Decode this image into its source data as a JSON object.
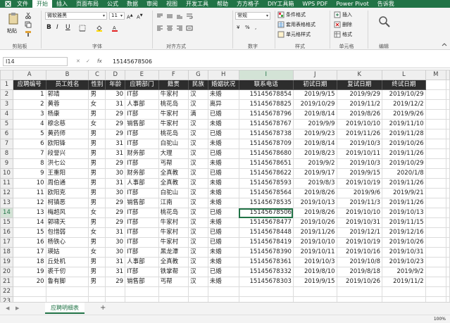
{
  "ribbon_tabs": [
    "文件",
    "开始",
    "插入",
    "页面布局",
    "公式",
    "数据",
    "审阅",
    "视图",
    "开发工具",
    "帮助",
    "方方格子",
    "DIY工具箱",
    "WPS PDF",
    "Power Pivot",
    "告诉我"
  ],
  "ribbon": {
    "paste": "粘贴",
    "font_name": "微软雅黑",
    "font_size": "11",
    "bold": "B",
    "italic": "I",
    "underline": "U",
    "wrap_label": "常规",
    "cond_format": "条件格式",
    "table_format": "套用表格格式",
    "cell_style": "单元格样式",
    "insert": "插入",
    "delete": "删除",
    "format": "格式",
    "groups": {
      "clipboard": "剪贴板",
      "font": "字体",
      "align": "对齐方式",
      "number": "数字",
      "styles": "样式",
      "cells": "单元格",
      "edit": "编辑"
    }
  },
  "formula_bar": {
    "name_box": "I14",
    "fx": "fx",
    "value": "15145678506"
  },
  "columns": [
    "A",
    "B",
    "C",
    "D",
    "E",
    "F",
    "G",
    "H",
    "I",
    "J",
    "K",
    "L",
    "M"
  ],
  "headers": [
    "应聘编号",
    "员工姓名",
    "性别",
    "年龄",
    "应聘部门",
    "籍贯",
    "民族",
    "婚姻状况",
    "联系电话",
    "初试日期",
    "复试日期",
    "终试日期"
  ],
  "rows": [
    [
      "1",
      "郭靖",
      "男",
      "30",
      "IT部",
      "牛家村",
      "汉",
      "未婚",
      "15145678854",
      "2019/9/15",
      "2019/9/29",
      "2019/10/29"
    ],
    [
      "2",
      "黄蓉",
      "女",
      "31",
      "人事部",
      "桃花岛",
      "汉",
      "离异",
      "15145678825",
      "2019/10/29",
      "2019/11/2",
      "2019/12/2"
    ],
    [
      "3",
      "杨康",
      "男",
      "29",
      "IT部",
      "牛家村",
      "满",
      "已婚",
      "15145678796",
      "2019/8/14",
      "2019/8/26",
      "2019/9/26"
    ],
    [
      "4",
      "穆念慈",
      "女",
      "29",
      "销售部",
      "牛家村",
      "汉",
      "未婚",
      "15145678767",
      "2019/9/9",
      "2019/10/10",
      "2019/11/10"
    ],
    [
      "5",
      "黄药师",
      "男",
      "29",
      "IT部",
      "桃花岛",
      "汉",
      "已婚",
      "15145678738",
      "2019/9/23",
      "2019/11/26",
      "2019/11/28"
    ],
    [
      "6",
      "欧阳锋",
      "男",
      "31",
      "IT部",
      "白驼山",
      "汉",
      "未婚",
      "15145678709",
      "2019/8/14",
      "2019/10/3",
      "2019/10/26"
    ],
    [
      "7",
      "段誉兴",
      "男",
      "31",
      "财务部",
      "大理",
      "汉",
      "已婚",
      "15145678680",
      "2019/8/23",
      "2019/10/11",
      "2019/11/26"
    ],
    [
      "8",
      "洪七公",
      "男",
      "29",
      "IT部",
      "丐帮",
      "汉",
      "未婚",
      "15145678651",
      "2019/9/2",
      "2019/10/3",
      "2019/10/29"
    ],
    [
      "9",
      "王重阳",
      "男",
      "30",
      "财务部",
      "全真教",
      "汉",
      "已婚",
      "15145678622",
      "2019/9/17",
      "2019/9/15",
      "2020/1/8"
    ],
    [
      "10",
      "周伯通",
      "男",
      "31",
      "人事部",
      "全真教",
      "汉",
      "未婚",
      "15145678593",
      "2019/8/3",
      "2019/10/19",
      "2019/11/26"
    ],
    [
      "11",
      "欧阳克",
      "男",
      "30",
      "IT部",
      "白驼山",
      "汉",
      "未婚",
      "15145678564",
      "2019/8/26",
      "2019/9/6",
      "2019/9/21"
    ],
    [
      "12",
      "柯镇恶",
      "男",
      "29",
      "销售部",
      "江南",
      "汉",
      "未婚",
      "15145678535",
      "2019/10/13",
      "2019/11/3",
      "2019/11/26"
    ],
    [
      "13",
      "梅超风",
      "女",
      "29",
      "IT部",
      "桃花岛",
      "汉",
      "已婚",
      "15145678506",
      "2019/8/26",
      "2019/10/10",
      "2019/10/13"
    ],
    [
      "14",
      "郭啸天",
      "男",
      "29",
      "IT部",
      "牛家村",
      "汉",
      "未婚",
      "15145678477",
      "2019/10/26",
      "2019/10/31",
      "2019/11/15"
    ],
    [
      "15",
      "包惜弱",
      "女",
      "31",
      "IT部",
      "牛家村",
      "汉",
      "已婚",
      "15145678448",
      "2019/11/26",
      "2019/12/1",
      "2019/12/16"
    ],
    [
      "16",
      "杨铁心",
      "男",
      "30",
      "IT部",
      "牛家村",
      "汉",
      "已婚",
      "15145678419",
      "2019/10/10",
      "2019/10/19",
      "2019/10/26"
    ],
    [
      "17",
      "瑛姑",
      "女",
      "30",
      "IT部",
      "黑龙潭",
      "汉",
      "未婚",
      "15145678390",
      "2019/10/11",
      "2019/10/16",
      "2019/10/31"
    ],
    [
      "18",
      "丘处机",
      "男",
      "31",
      "人事部",
      "全真教",
      "汉",
      "未婚",
      "15145678361",
      "2019/10/3",
      "2019/10/8",
      "2019/10/23"
    ],
    [
      "19",
      "裘千仞",
      "男",
      "31",
      "IT部",
      "铁掌帮",
      "汉",
      "已婚",
      "15145678332",
      "2019/8/10",
      "2019/8/18",
      "2019/9/2"
    ],
    [
      "20",
      "鲁有脚",
      "男",
      "29",
      "销售部",
      "丐帮",
      "汉",
      "未婚",
      "15145678303",
      "2019/9/15",
      "2019/10/26",
      "2019/11/2"
    ]
  ],
  "empty_rows": [
    "22",
    "23"
  ],
  "sheet_tab": "应聘明细表",
  "status_zoom": "100%",
  "add_sheet": "+",
  "colors": {
    "accent": "#217346",
    "header_fill": "#2d2d2d"
  }
}
